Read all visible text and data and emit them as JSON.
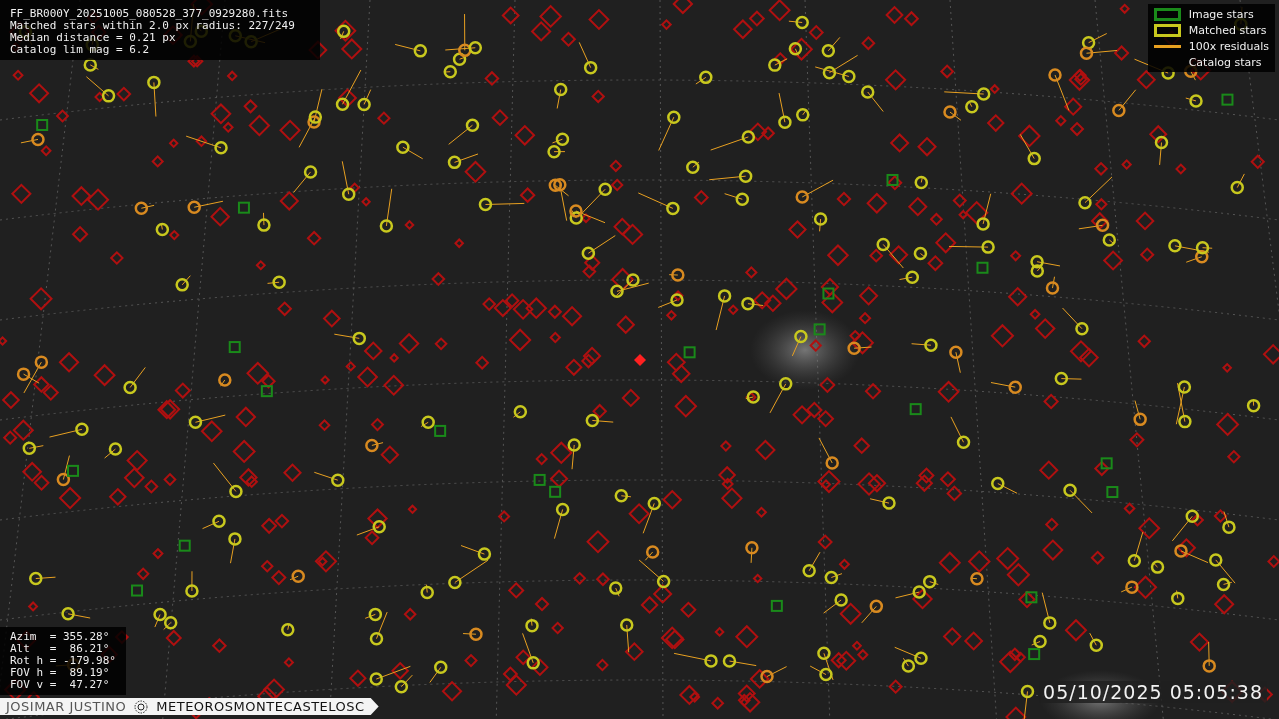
{
  "header": {
    "lines": [
      "FF_BR000Y_20251005_080528_377_0929280.fits",
      "Matched stars within 2.0 px radius: 227/249",
      "Median distance = 0.21 px",
      "Catalog lim mag = 6.2"
    ]
  },
  "legend": [
    {
      "label": "Image stars",
      "kind": "box",
      "color": "#1a8a1a"
    },
    {
      "label": "Matched stars",
      "kind": "box",
      "color": "#c8c81e"
    },
    {
      "label": "100x residuals",
      "kind": "line",
      "color": "#e8a020"
    },
    {
      "label": "Catalog stars",
      "kind": "none"
    }
  ],
  "pointing": {
    "lines": [
      "Azim  = 355.28°",
      "Alt   =  86.21°",
      "Rot h = -179.98°",
      "FOV h =  89.19°",
      "FOV v =  47.27°"
    ]
  },
  "banner": {
    "author": "JOSIMAR JUSTINO",
    "station": "METEOROSMONTECASTELOSC"
  },
  "timestamp": "05/10/2025 05:05:38"
}
